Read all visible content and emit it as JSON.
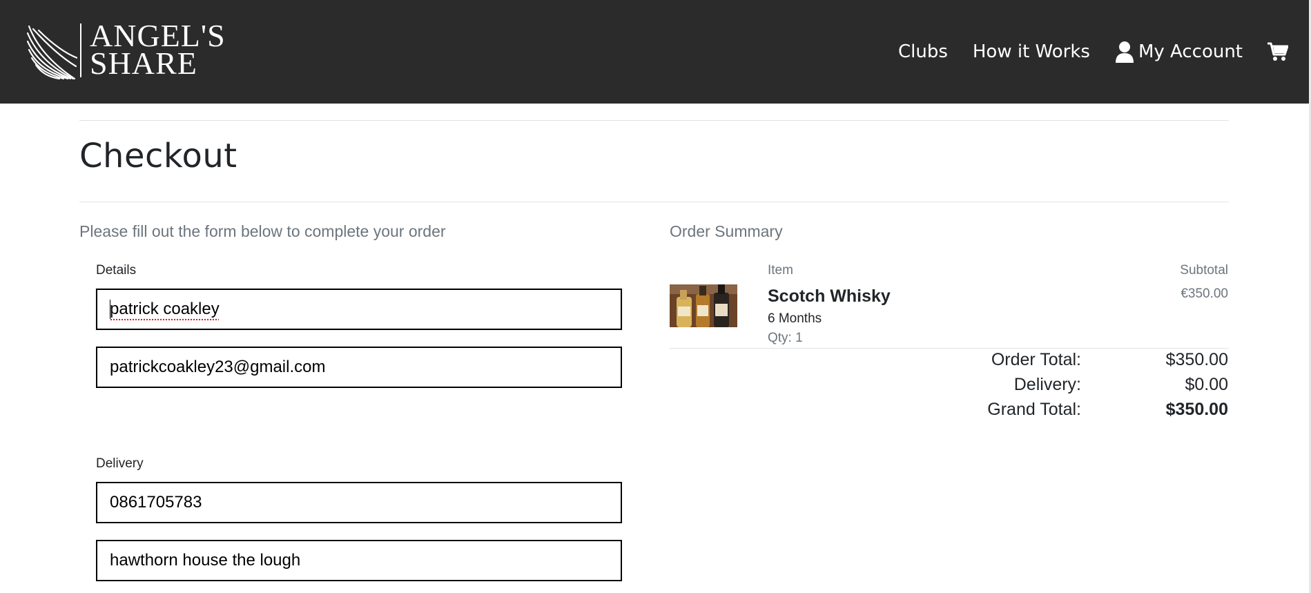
{
  "header": {
    "logo_line1": "ANGEL'S",
    "logo_line2": "SHARE",
    "nav": [
      "Clubs",
      "How it Works",
      "My Account"
    ]
  },
  "page": {
    "title": "Checkout",
    "instructions": "Please fill out the form below to complete your order",
    "summary_heading": "Order Summary"
  },
  "form": {
    "details_label": "Details",
    "delivery_label": "Delivery",
    "full_name": "patrick coakley",
    "email": "patrickcoakley23@gmail.com",
    "phone": "0861705783",
    "street_address1": "hawthorn house the lough"
  },
  "summary": {
    "col_item": "Item",
    "col_subtotal": "Subtotal",
    "item": {
      "name": "Scotch Whisky",
      "plan": "6 Months",
      "qty": "Qty: 1",
      "subtotal": "€350.00",
      "image_icon": "whisky-bottles-image"
    },
    "totals": [
      {
        "label": "Order Total:",
        "value": "$350.00"
      },
      {
        "label": "Delivery:",
        "value": "$0.00"
      },
      {
        "label": "Grand Total:",
        "value": "$350.00"
      }
    ]
  },
  "colors": {
    "header_bg": "#2b2b2b",
    "text": "#212529",
    "muted": "#6c757d",
    "input_border": "#000000"
  }
}
